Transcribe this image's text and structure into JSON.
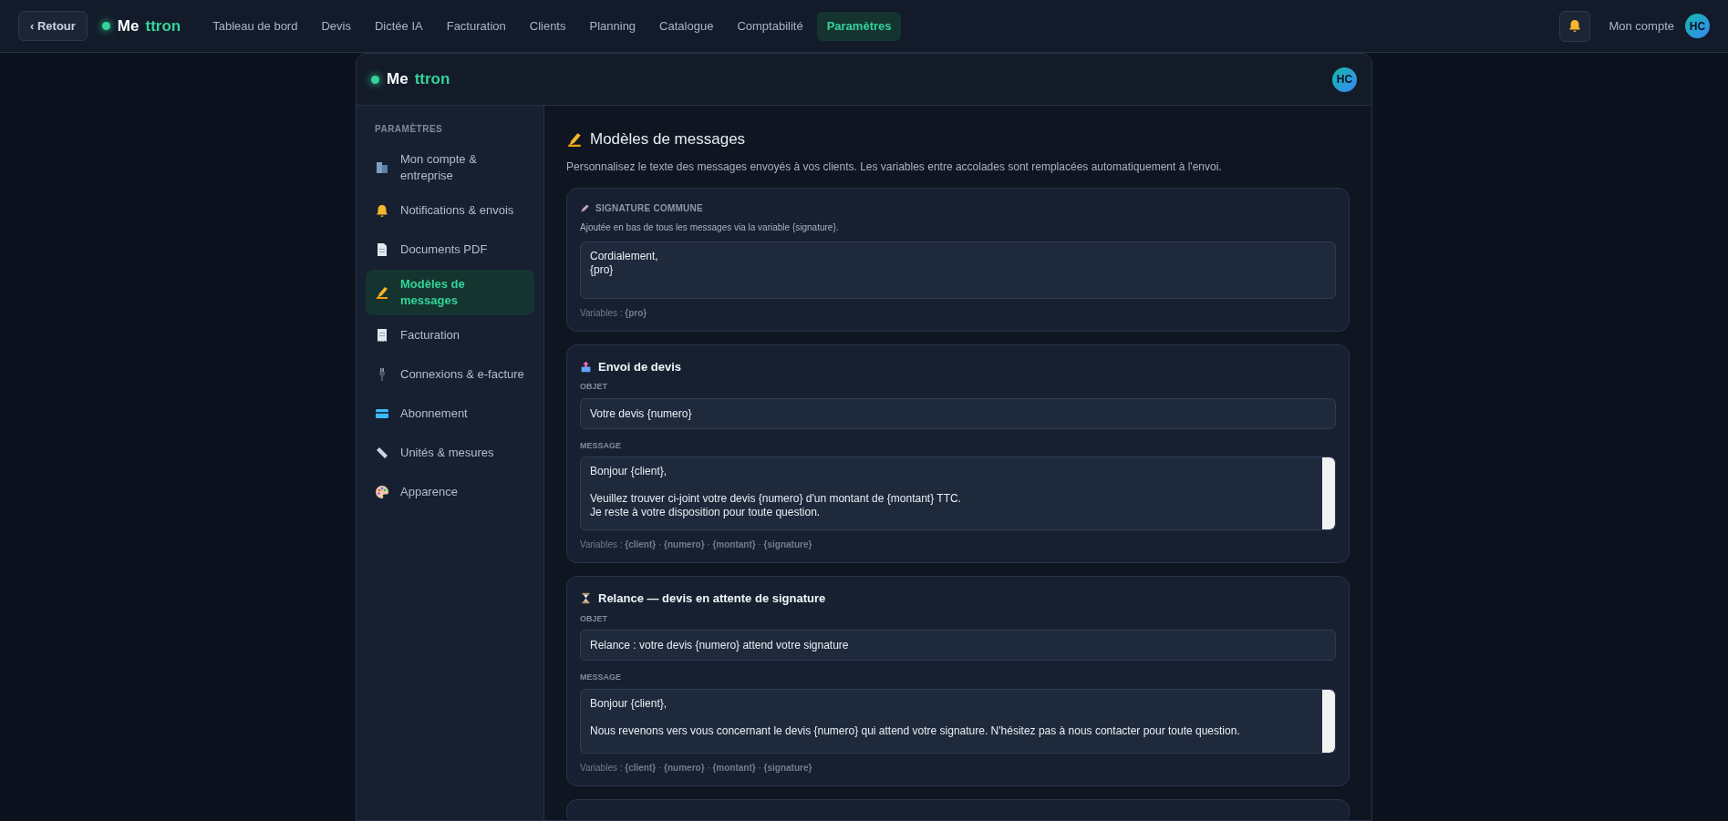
{
  "topbar": {
    "back_button": "‹ Retour",
    "logo": {
      "part_1": "Me",
      "part_2": "ttron"
    },
    "nav": [
      {
        "label": "Tableau de bord",
        "selected": false
      },
      {
        "label": "Devis",
        "selected": false
      },
      {
        "label": "Dictée IA",
        "selected": false
      },
      {
        "label": "Facturation",
        "selected": false
      },
      {
        "label": "Clients",
        "selected": false
      },
      {
        "label": "Planning",
        "selected": false
      },
      {
        "label": "Catalogue",
        "selected": false
      },
      {
        "label": "Comptabilité",
        "selected": false
      },
      {
        "label": "Paramètres",
        "selected": true
      }
    ],
    "account_label": "Mon compte",
    "avatar": "HC"
  },
  "panel": {
    "logo": {
      "part_1": "Me",
      "part_2": "ttron"
    },
    "avatar": "HC"
  },
  "sidebar": {
    "heading": "PARAMÈTRES",
    "items": [
      {
        "label": "Mon compte & entreprise",
        "selected": false
      },
      {
        "label": "Notifications & envois",
        "selected": false
      },
      {
        "label": "Documents PDF",
        "selected": false
      },
      {
        "label": "Modèles de messages",
        "selected": true
      },
      {
        "label": "Facturation",
        "selected": false
      },
      {
        "label": "Connexions & e-facture",
        "selected": false
      },
      {
        "label": "Abonnement",
        "selected": false
      },
      {
        "label": "Unités & mesures",
        "selected": false
      },
      {
        "label": "Apparence",
        "selected": false
      }
    ]
  },
  "content": {
    "title": "Modèles de messages",
    "description": "Personnalisez le texte des messages envoyés à vos clients. Les variables entre accolades sont remplacées automatiquement à l'envoi.",
    "signature": {
      "heading": "SIGNATURE COMMUNE",
      "hint": "Ajoutée en bas de tous les messages via la variable {signature}.",
      "value": "Cordialement,\n{pro}",
      "variables": "Variables : **{pro}**"
    },
    "templates": [
      {
        "title": "Envoi de devis",
        "subject_label": "OBJET",
        "subject": "Votre devis {numero}",
        "message_label": "MESSAGE",
        "message": "Bonjour {client},\n\nVeuillez trouver ci-joint votre devis {numero} d'un montant de {montant} TTC.\nJe reste à votre disposition pour toute question.",
        "variables": "Variables : **{client}** · **{numero}** · **{montant}** · **{signature}**"
      },
      {
        "title": "Relance — devis en attente de signature",
        "subject_label": "OBJET",
        "subject": "Relance : votre devis {numero} attend votre signature",
        "message_label": "MESSAGE",
        "message": "Bonjour {client},\n\nNous revenons vers vous concernant le devis {numero} qui attend votre signature. N'hésitez pas à nous contacter pour toute question.",
        "variables": "Variables : **{client}** · **{numero}** · **{montant}** · **{signature}**"
      }
    ]
  }
}
